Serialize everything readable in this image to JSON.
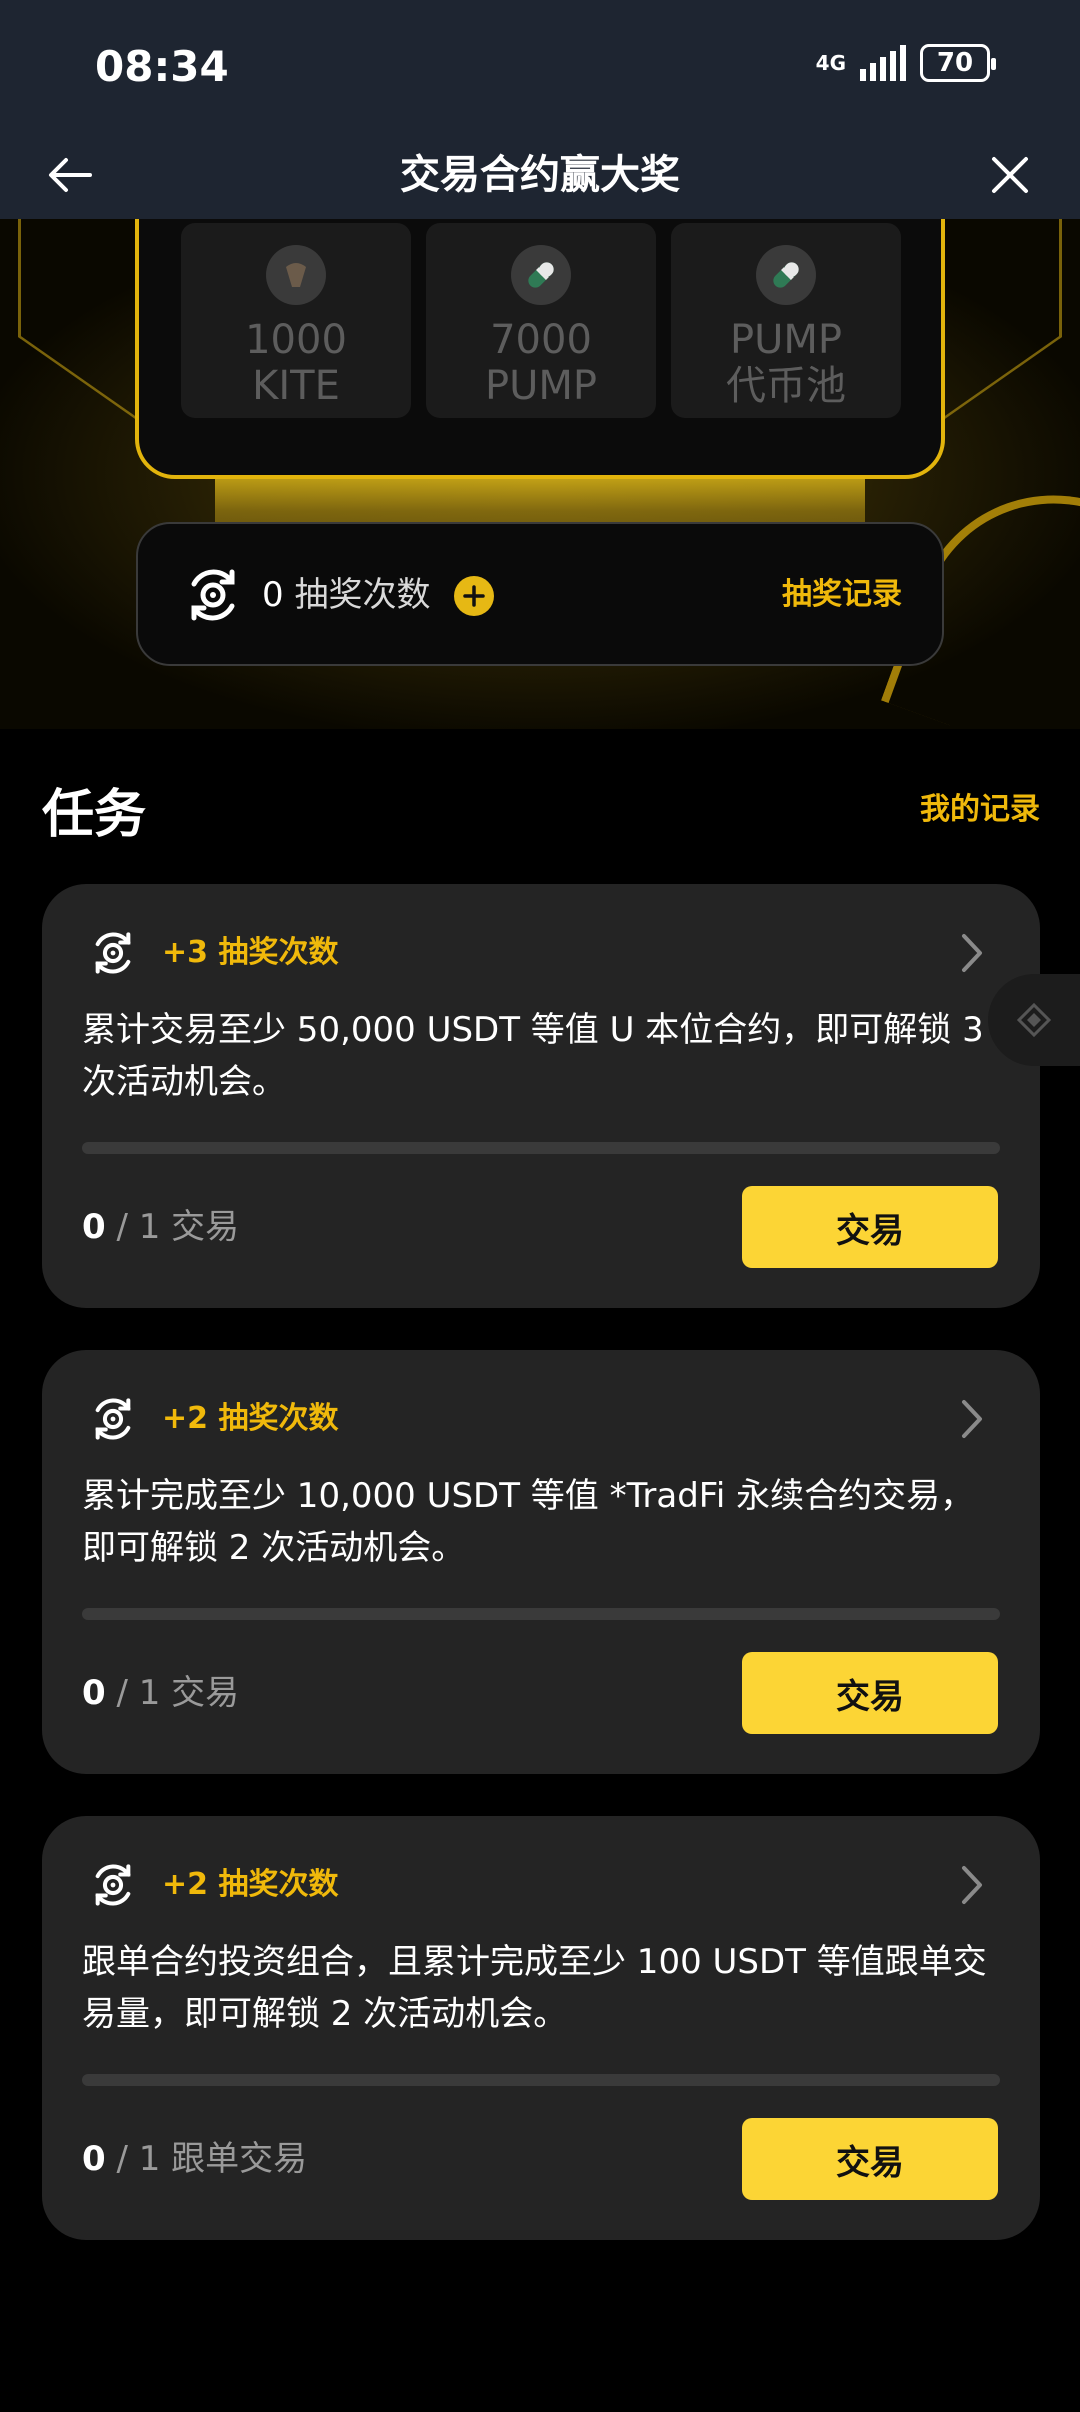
{
  "status_bar": {
    "time": "08:34",
    "network": "4G",
    "battery": "70"
  },
  "header": {
    "title": "交易合约赢大奖"
  },
  "hero": {
    "prizes": [
      {
        "line1": "1000",
        "line2": "KITE",
        "icon": "kite-token-icon"
      },
      {
        "line1": "7000",
        "line2": "PUMP",
        "icon": "pill-icon"
      },
      {
        "line1": "PUMP",
        "line2": "代币池",
        "icon": "pill-icon"
      }
    ],
    "draw_count": "0",
    "draw_count_label": "抽奖次数",
    "draw_record_label": "抽奖记录"
  },
  "tasks": {
    "title": "任务",
    "my_record_label": "我的记录",
    "items": [
      {
        "reward": "+3 抽奖次数",
        "description": "累计交易至少 50,000 USDT 等值 U 本位合约，即可解锁 3 次活动机会。",
        "progress_done": "0",
        "progress_rest": " / 1 交易",
        "progress_fraction": 0,
        "button_label": "交易"
      },
      {
        "reward": "+2 抽奖次数",
        "description": "累计完成至少 10,000 USDT 等值 *TradFi 永续合约交易，即可解锁 2 次活动机会。",
        "progress_done": "0",
        "progress_rest": " / 1 交易",
        "progress_fraction": 0,
        "button_label": "交易"
      },
      {
        "reward": "+2 抽奖次数",
        "description": "跟单合约投资组合，且累计完成至少 100 USDT 等值跟单交易量，即可解锁 2 次活动机会。",
        "progress_done": "0",
        "progress_rest": " / 1 跟单交易",
        "progress_fraction": 0,
        "button_label": "交易"
      }
    ]
  },
  "colors": {
    "accent": "#f0b90b",
    "button": "#fcd535",
    "card": "#242424",
    "header_bg": "#1e2531"
  }
}
